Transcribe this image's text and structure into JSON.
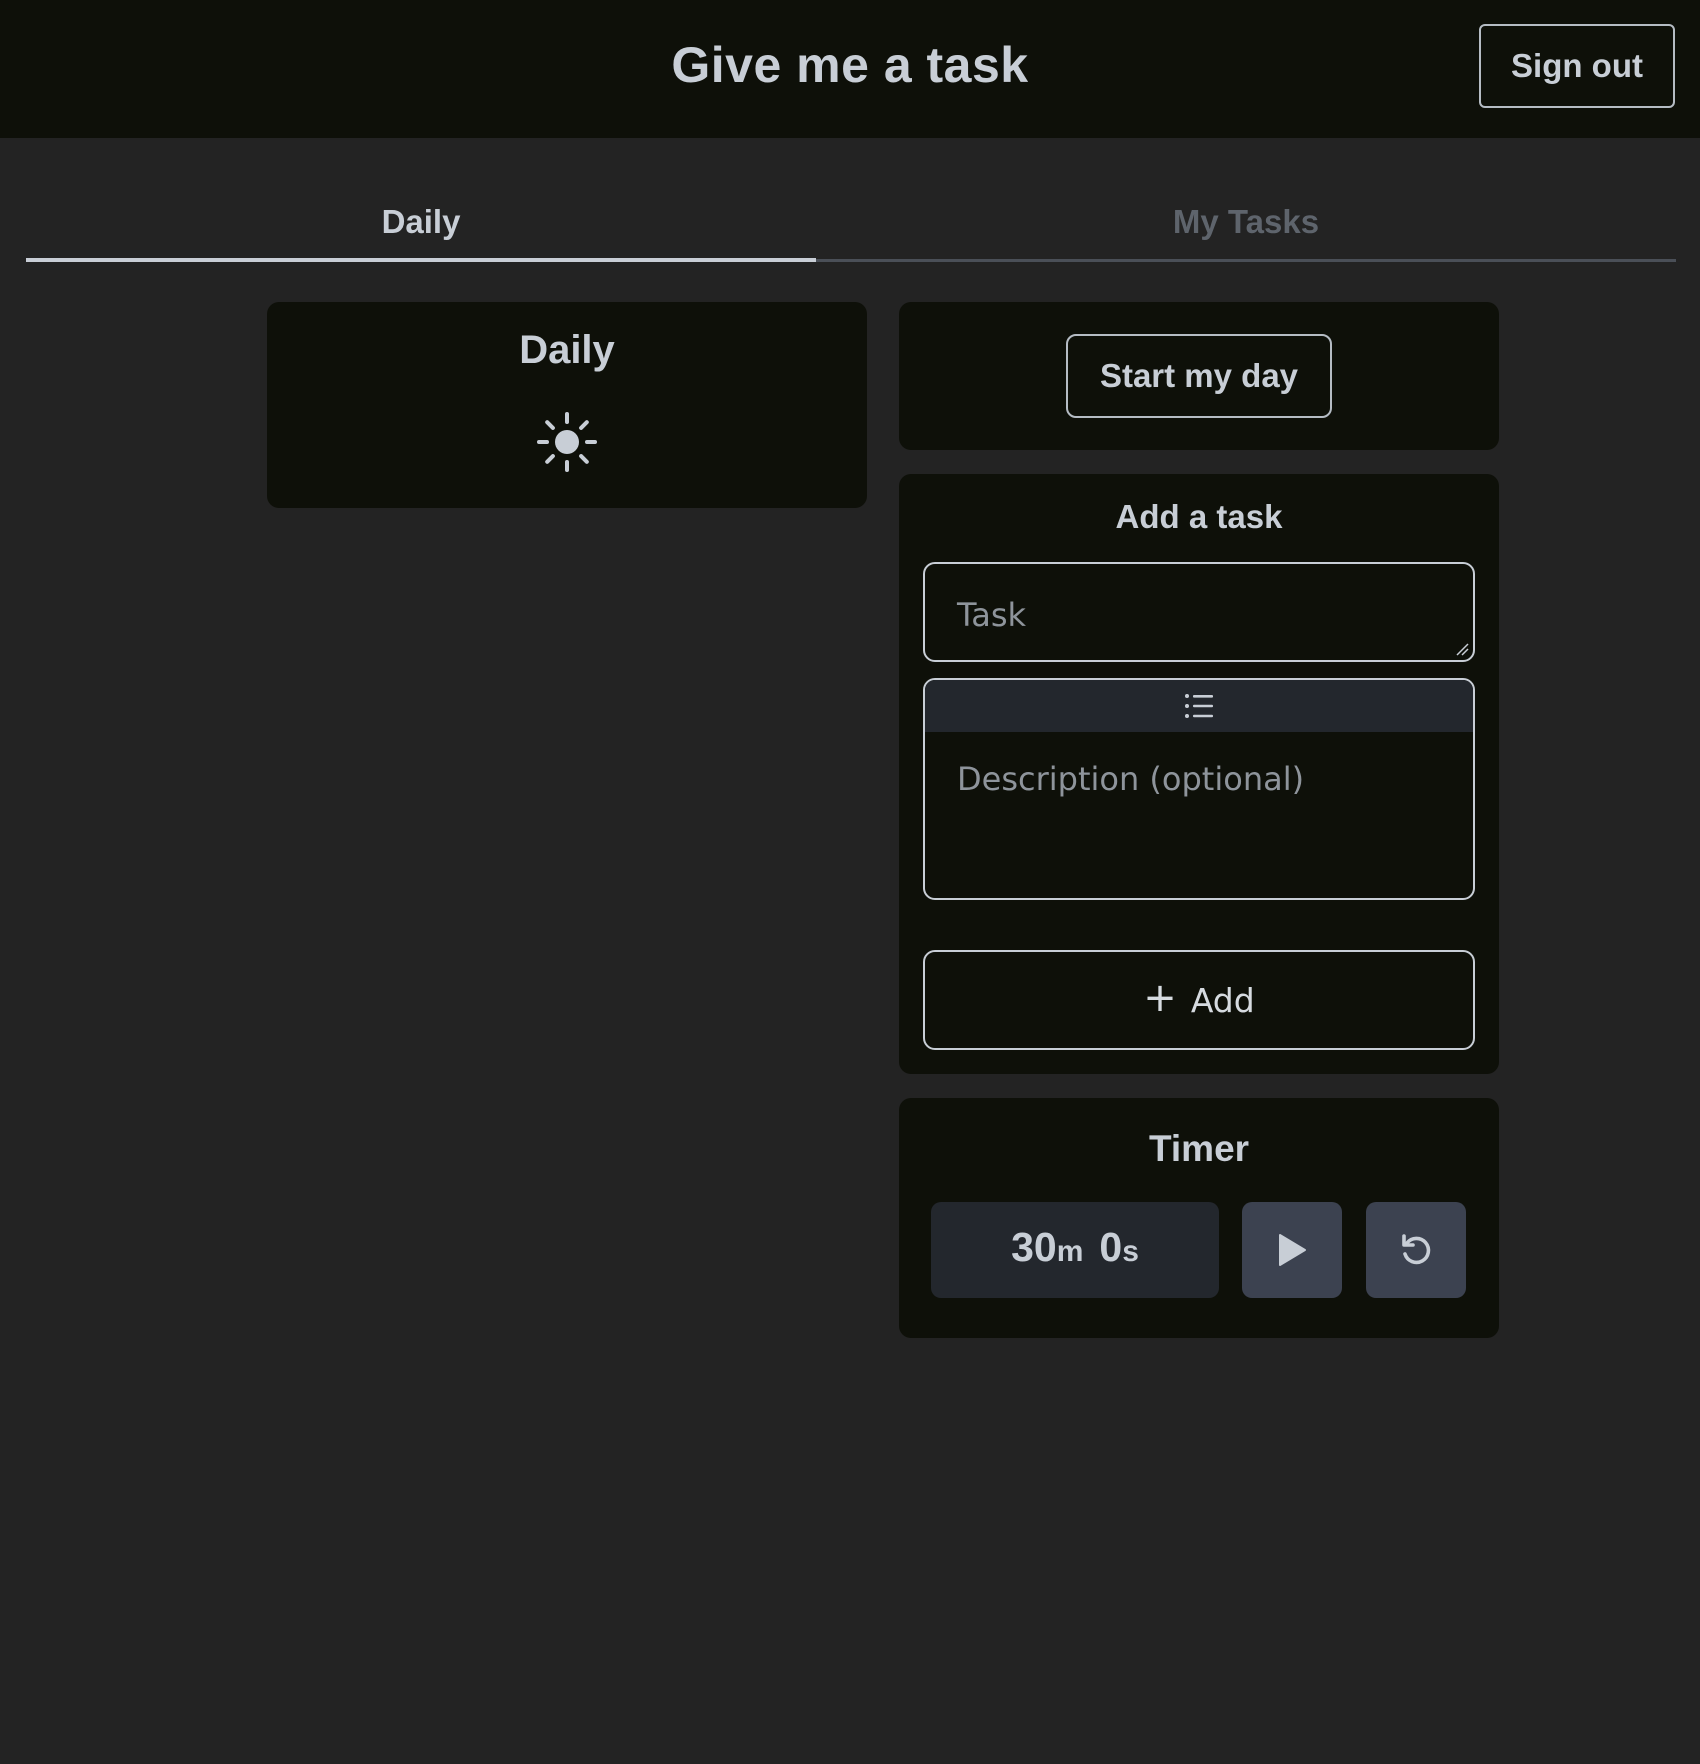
{
  "header": {
    "title": "Give me a task",
    "signout_label": "Sign out"
  },
  "tabs": [
    {
      "label": "Daily",
      "active": true
    },
    {
      "label": "My Tasks",
      "active": false
    }
  ],
  "daily_card": {
    "title": "Daily",
    "icon": "sun-icon"
  },
  "start_card": {
    "button_label": "Start my day"
  },
  "add_task": {
    "title": "Add a task",
    "task_placeholder": "Task",
    "description_placeholder": "Description (optional)",
    "toolbar_icon": "list-icon",
    "add_label": "Add",
    "add_icon": "+"
  },
  "timer": {
    "title": "Timer",
    "minutes": "30",
    "minutes_unit": "m",
    "seconds": "0",
    "seconds_unit": "s",
    "play_icon": "play-icon",
    "reset_icon": "reset-icon"
  },
  "colors": {
    "background": "#232323",
    "surface": "#0e1009",
    "text": "#c8ced6",
    "muted_text": "#5e646c",
    "button_fill": "#3c4250"
  }
}
